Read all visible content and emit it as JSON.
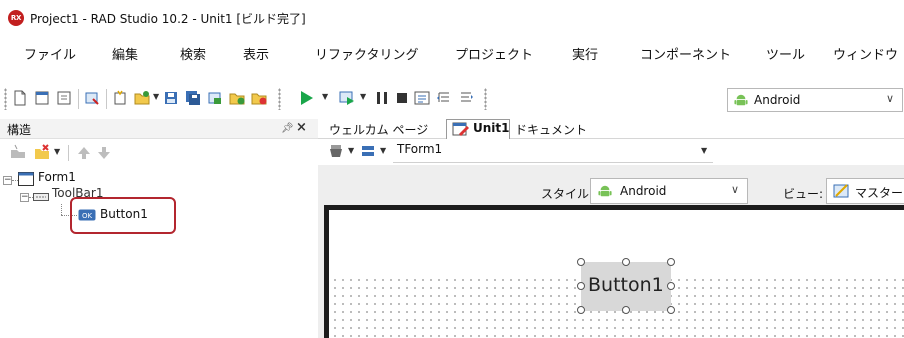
{
  "window": {
    "logo_text": "RX",
    "title": "Project1 - RAD Studio 10.2 - Unit1 [ビルド完了]"
  },
  "menu": [
    "ファイル",
    "編集",
    "検索",
    "表示",
    "リファクタリング",
    "プロジェクト",
    "実行",
    "コンポーネント",
    "ツール",
    "ウィンドウ"
  ],
  "toolbar": {
    "platform": "Android"
  },
  "structure": {
    "title": "構造",
    "tree": [
      {
        "label": "Form1",
        "level": 0
      },
      {
        "label": "ToolBar1",
        "level": 1
      },
      {
        "label": "Button1",
        "level": 2
      }
    ]
  },
  "editor": {
    "tabs": [
      "ウェルカム ページ",
      "Unit1",
      "ドキュメント"
    ],
    "active_tab": "Unit1",
    "form_selector": "TForm1",
    "style_label": "スタイル:",
    "style_value": "Android",
    "view_label": "ビュー:",
    "view_value": "マスター",
    "design_button_label": "Button1"
  },
  "colors": {
    "highlight": "#b3262f",
    "logo_red": "#c21f1f",
    "run_green": "#1aa64a",
    "android_green": "#78c257",
    "form_border": "#1c1c1c"
  }
}
